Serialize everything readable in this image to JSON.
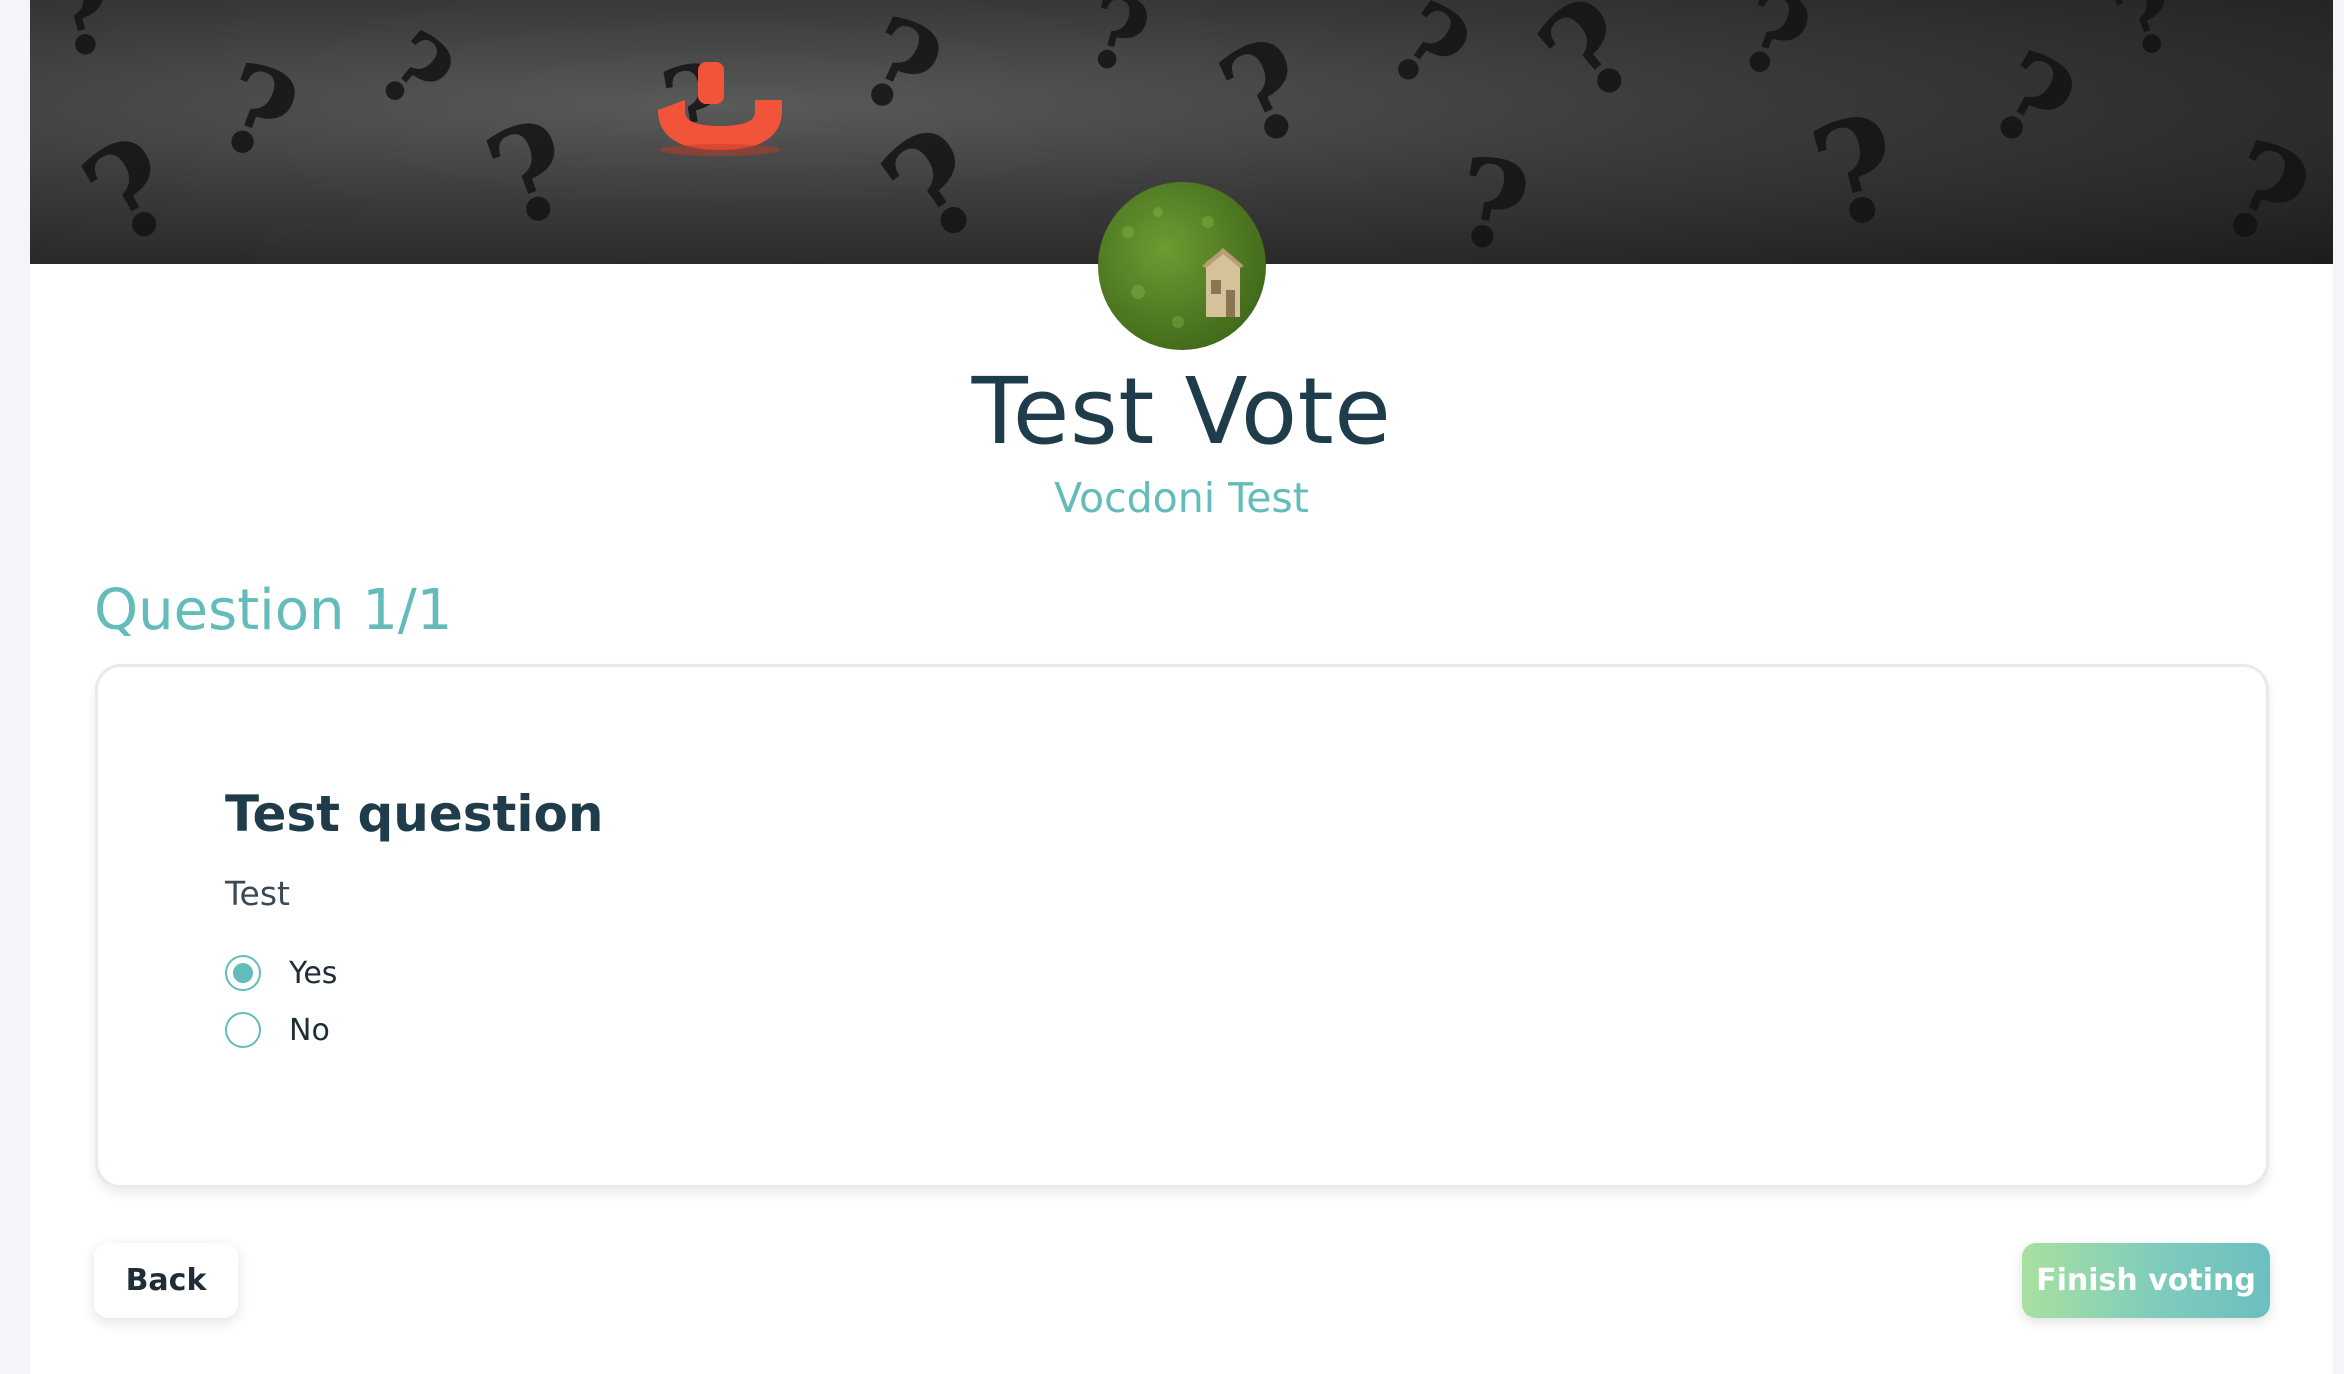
{
  "header": {
    "banner_icon": "question-marks-banner-image",
    "avatar_icon": "house-on-grass-avatar-image",
    "title": "Test Vote",
    "subtitle": "Vocdoni Test"
  },
  "question": {
    "counter": "Question 1/1",
    "title": "Test question",
    "description": "Test",
    "options": [
      {
        "label": "Yes",
        "selected": true
      },
      {
        "label": "No",
        "selected": false
      }
    ]
  },
  "actions": {
    "back_label": "Back",
    "finish_label": "Finish voting"
  },
  "colors": {
    "accent": "#63bcba",
    "heading": "#1f3c4a",
    "finish_gradient_start": "#a8e0a0",
    "finish_gradient_end": "#6cbfc0"
  }
}
